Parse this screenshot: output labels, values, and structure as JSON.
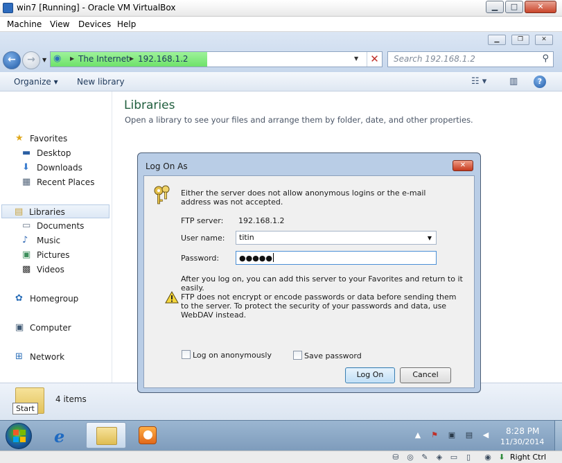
{
  "vbox": {
    "title": "win7 [Running] - Oracle VM VirtualBox",
    "menu": [
      "Machine",
      "View",
      "Devices",
      "Help"
    ],
    "status_host_key": "Right Ctrl"
  },
  "explorer": {
    "address_crumbs": [
      "The Internet",
      "192.168.1.2"
    ],
    "search_placeholder": "Search 192.168.1.2",
    "commands": {
      "organize": "Organize",
      "new_library": "New library"
    },
    "nav": {
      "favorites": "Favorites",
      "desktop": "Desktop",
      "downloads": "Downloads",
      "recent_places": "Recent Places",
      "libraries": "Libraries",
      "documents": "Documents",
      "music": "Music",
      "pictures": "Pictures",
      "videos": "Videos",
      "homegroup": "Homegroup",
      "computer": "Computer",
      "network": "Network"
    },
    "content_title": "Libraries",
    "content_subtitle": "Open a library to see your files and arrange them by folder, date, and other properties.",
    "item_count": "4 items",
    "start_tooltip": "Start"
  },
  "dialog": {
    "title": "Log On As",
    "message": "Either the server does not allow anonymous logins or the e-mail address was not accepted.",
    "ftp_server_label": "FTP server:",
    "ftp_server_value": "192.168.1.2",
    "user_name_label": "User name:",
    "user_name_value": "titin",
    "password_label": "Password:",
    "password_masked": "●●●●●",
    "favorites_note": "After you log on, you can add this server to your Favorites and return to it easily.",
    "warning": "FTP does not encrypt or encode passwords or data before sending them to the server.  To protect the security of your passwords and data, use WebDAV instead.",
    "log_on_anonymously": "Log on anonymously",
    "save_password": "Save password",
    "log_on_button": "Log On",
    "cancel_button": "Cancel"
  },
  "taskbar": {
    "time": "8:28 PM",
    "date": "11/30/2014"
  },
  "colors": {
    "address_progress": "#6ee26a",
    "dialog_frame": "#b9cde6",
    "taskbar": "#7e9cbc"
  }
}
